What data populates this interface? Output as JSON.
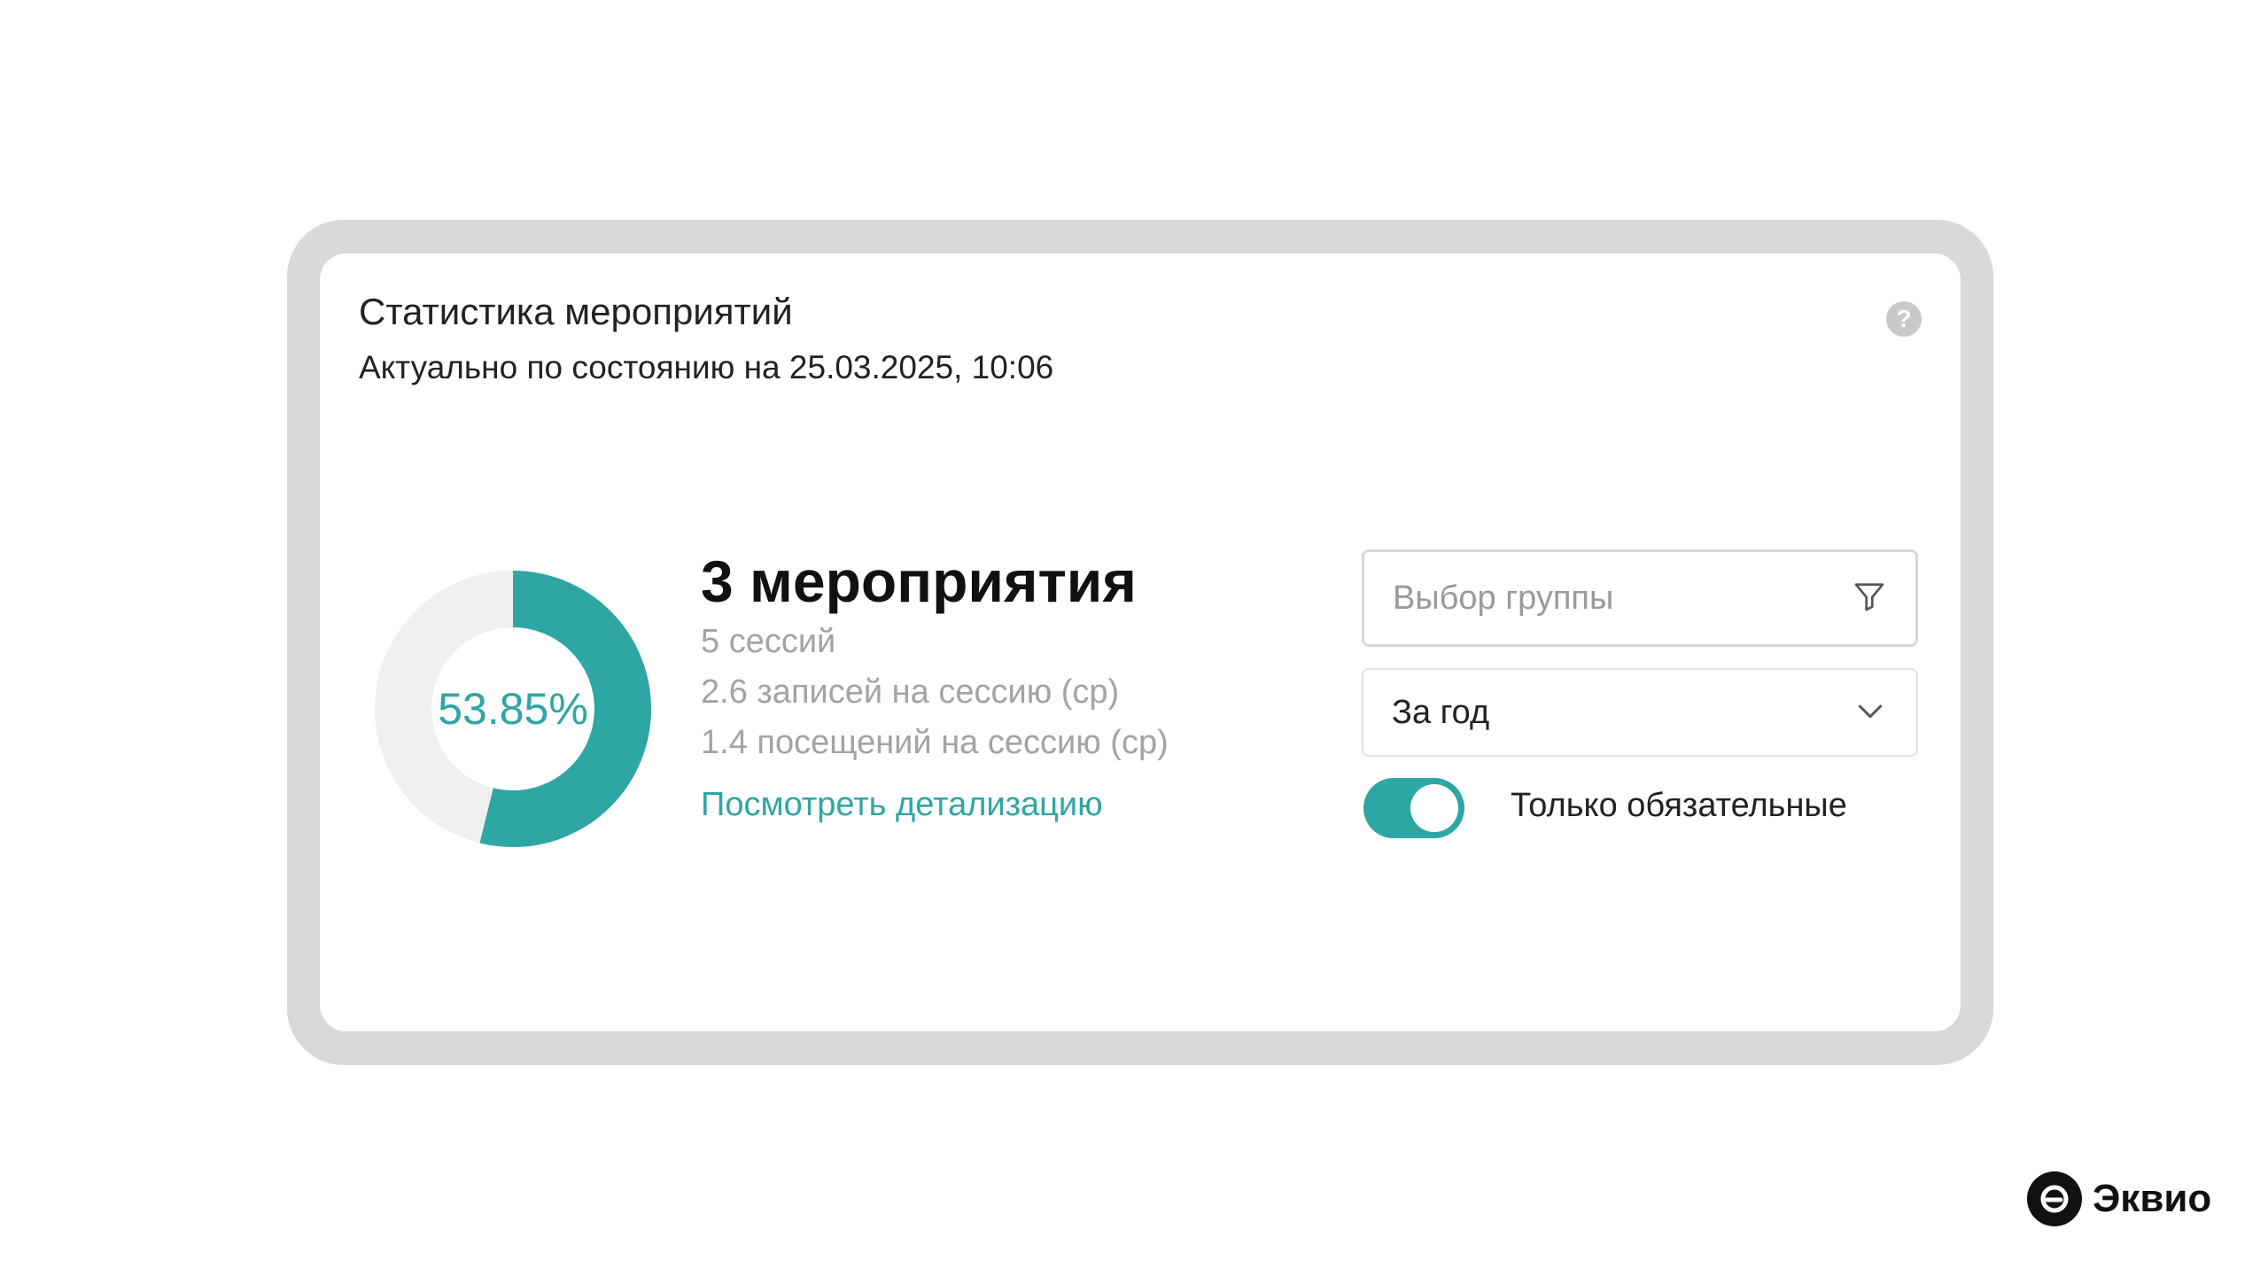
{
  "widget": {
    "title": "Статистика мероприятий",
    "subtitle": "Актуально по состоянию на 25.03.2025, 10:06",
    "help_icon": "?"
  },
  "donut": {
    "percent": 53.85,
    "label": "53.85%",
    "fill_color": "#2ea6a4",
    "track_color": "#f0f0f0"
  },
  "stats": {
    "heading": "3 мероприятия",
    "lines": [
      "5 сессий",
      "2.6 записей на сессию (ср)",
      "1.4 посещений на сессию (ср)"
    ],
    "link": "Посмотреть детализацию"
  },
  "filters": {
    "group_placeholder": "Выбор группы",
    "period_value": "За год",
    "toggle_label": "Только обязательные",
    "toggle_on": true
  },
  "brand": {
    "name": "Эквио"
  },
  "colors": {
    "accent": "#2ea6a4",
    "frame": "#d9d9d9"
  }
}
